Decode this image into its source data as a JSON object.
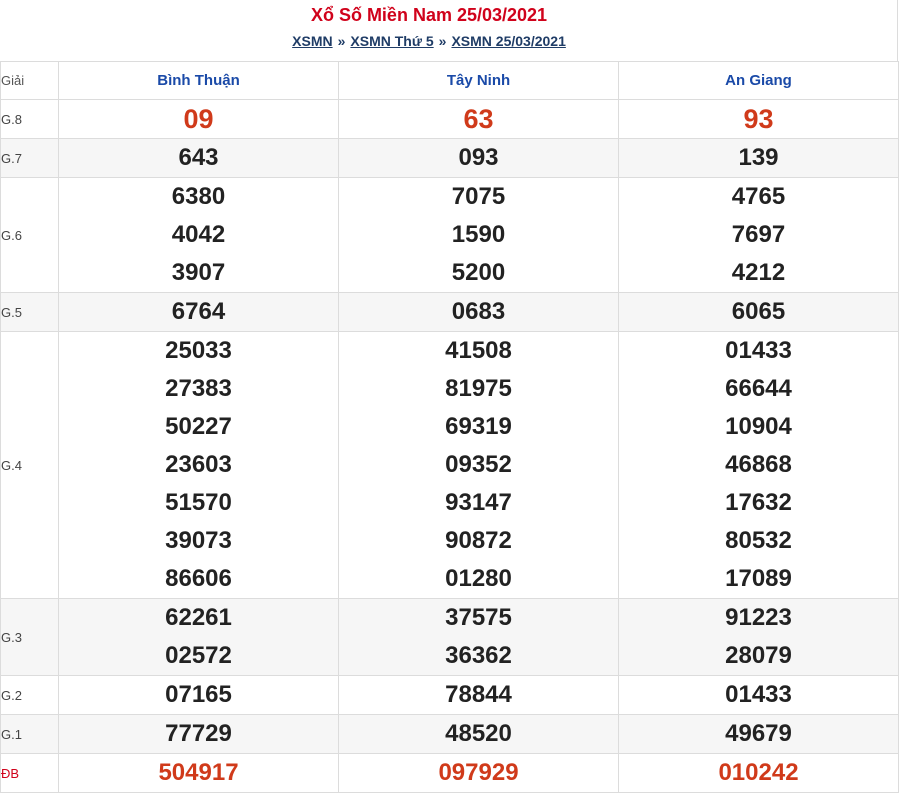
{
  "header": {
    "title": "Xổ Số Miền Nam 25/03/2021",
    "breadcrumb": [
      "XSMN",
      "XSMN Thứ 5",
      "XSMN 25/03/2021"
    ],
    "separator": "»"
  },
  "table": {
    "label_header": "Giải",
    "provinces": [
      "Bình Thuận",
      "Tây Ninh",
      "An Giang"
    ],
    "rows": [
      {
        "label": "G.8",
        "values": [
          [
            "09"
          ],
          [
            "63"
          ],
          [
            "93"
          ]
        ]
      },
      {
        "label": "G.7",
        "values": [
          [
            "643"
          ],
          [
            "093"
          ],
          [
            "139"
          ]
        ]
      },
      {
        "label": "G.6",
        "values": [
          [
            "6380",
            "4042",
            "3907"
          ],
          [
            "7075",
            "1590",
            "5200"
          ],
          [
            "4765",
            "7697",
            "4212"
          ]
        ]
      },
      {
        "label": "G.5",
        "values": [
          [
            "6764"
          ],
          [
            "0683"
          ],
          [
            "6065"
          ]
        ]
      },
      {
        "label": "G.4",
        "values": [
          [
            "25033",
            "27383",
            "50227",
            "23603",
            "51570",
            "39073",
            "86606"
          ],
          [
            "41508",
            "81975",
            "69319",
            "09352",
            "93147",
            "90872",
            "01280"
          ],
          [
            "01433",
            "66644",
            "10904",
            "46868",
            "17632",
            "80532",
            "17089"
          ]
        ]
      },
      {
        "label": "G.3",
        "values": [
          [
            "62261",
            "02572"
          ],
          [
            "37575",
            "36362"
          ],
          [
            "91223",
            "28079"
          ]
        ]
      },
      {
        "label": "G.2",
        "values": [
          [
            "07165"
          ],
          [
            "78844"
          ],
          [
            "01433"
          ]
        ]
      },
      {
        "label": "G.1",
        "values": [
          [
            "77729"
          ],
          [
            "48520"
          ],
          [
            "49679"
          ]
        ]
      },
      {
        "label": "ĐB",
        "values": [
          [
            "504917"
          ],
          [
            "097929"
          ],
          [
            "010242"
          ]
        ]
      }
    ]
  },
  "colors": {
    "title": "#d0021b",
    "link": "#1f3c66",
    "province": "#1a4aa8",
    "special": "#d03a1a"
  }
}
